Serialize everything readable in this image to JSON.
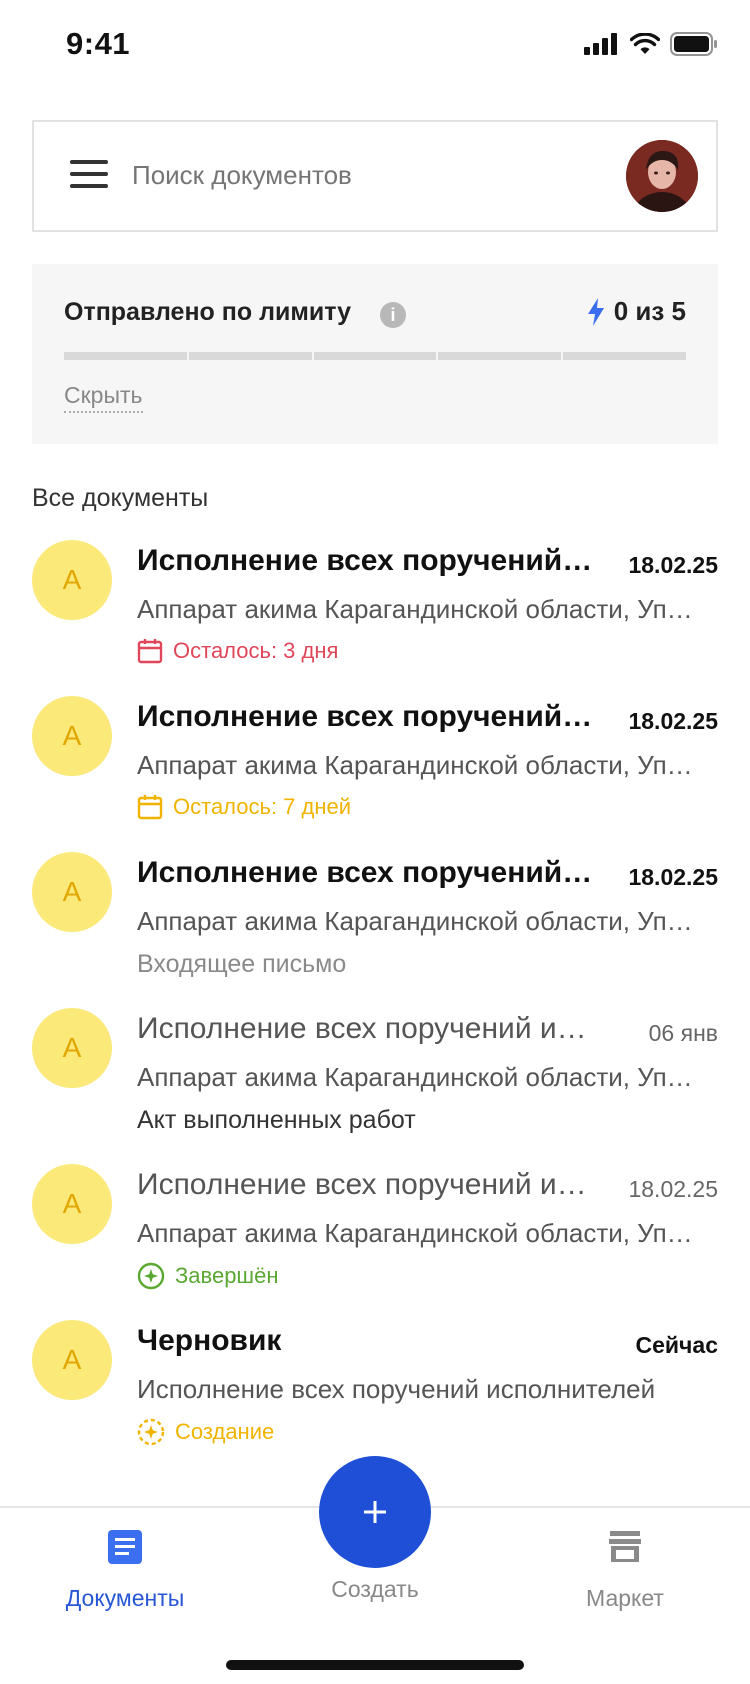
{
  "status_bar": {
    "time": "9:41"
  },
  "search": {
    "placeholder": "Поиск документов"
  },
  "limit": {
    "title": "Отправлено по лимиту",
    "counter": "0 из 5",
    "used": 0,
    "total": 5,
    "hide_label": "Скрыть"
  },
  "section": {
    "title": "Все документы"
  },
  "documents": [
    {
      "avatar": "А",
      "title": "Исполнение всех поручений исполнителей",
      "date": "18.02.25",
      "org": "Аппарат акима Карагандинской области, Управление",
      "status": "Осталось: 3 дня",
      "status_color": "#e0475a",
      "status_icon": "calendar-icon"
    },
    {
      "avatar": "А",
      "title": "Исполнение всех поручений исполнителей",
      "date": "18.02.25",
      "org": "Аппарат акима Карагандинской области, Управление",
      "status": "Осталось: 7 дней",
      "status_color": "#f0b400",
      "status_icon": "calendar-icon"
    },
    {
      "avatar": "А",
      "title": "Исполнение всех поручений исполнителей",
      "date": "18.02.25",
      "org": "Аппарат акима Карагандинской области, Управление",
      "status": "Входящее письмо",
      "status_color": "#8a8a8a"
    },
    {
      "avatar": "А",
      "title": "Исполнение всех поручений исполнителей",
      "date": "06 янв",
      "org": "Аппарат акима Карагандинской области, Управление",
      "status": "Акт выполненных работ",
      "status_color": "#333333"
    },
    {
      "avatar": "А",
      "title": "Исполнение всех поручений исполнителей",
      "date": "18.02.25",
      "org": "Аппарат акима Карагандинской области, Управление",
      "status": "Завершён",
      "status_color": "#5aa832",
      "status_icon": "completed-icon"
    },
    {
      "avatar": "А",
      "title": "Черновик",
      "date": "Сейчас",
      "org": "Исполнение всех поручений исполнителей",
      "status": "Создание",
      "status_color": "#f0b400",
      "status_icon": "creating-icon"
    }
  ],
  "bottom_nav": {
    "documents_label": "Документы",
    "create_label": "Создать",
    "market_label": "Маркет"
  },
  "colors": {
    "accent": "#1f4fd6",
    "avatar_bg": "#fbe97a",
    "avatar_text": "#e0a800"
  }
}
